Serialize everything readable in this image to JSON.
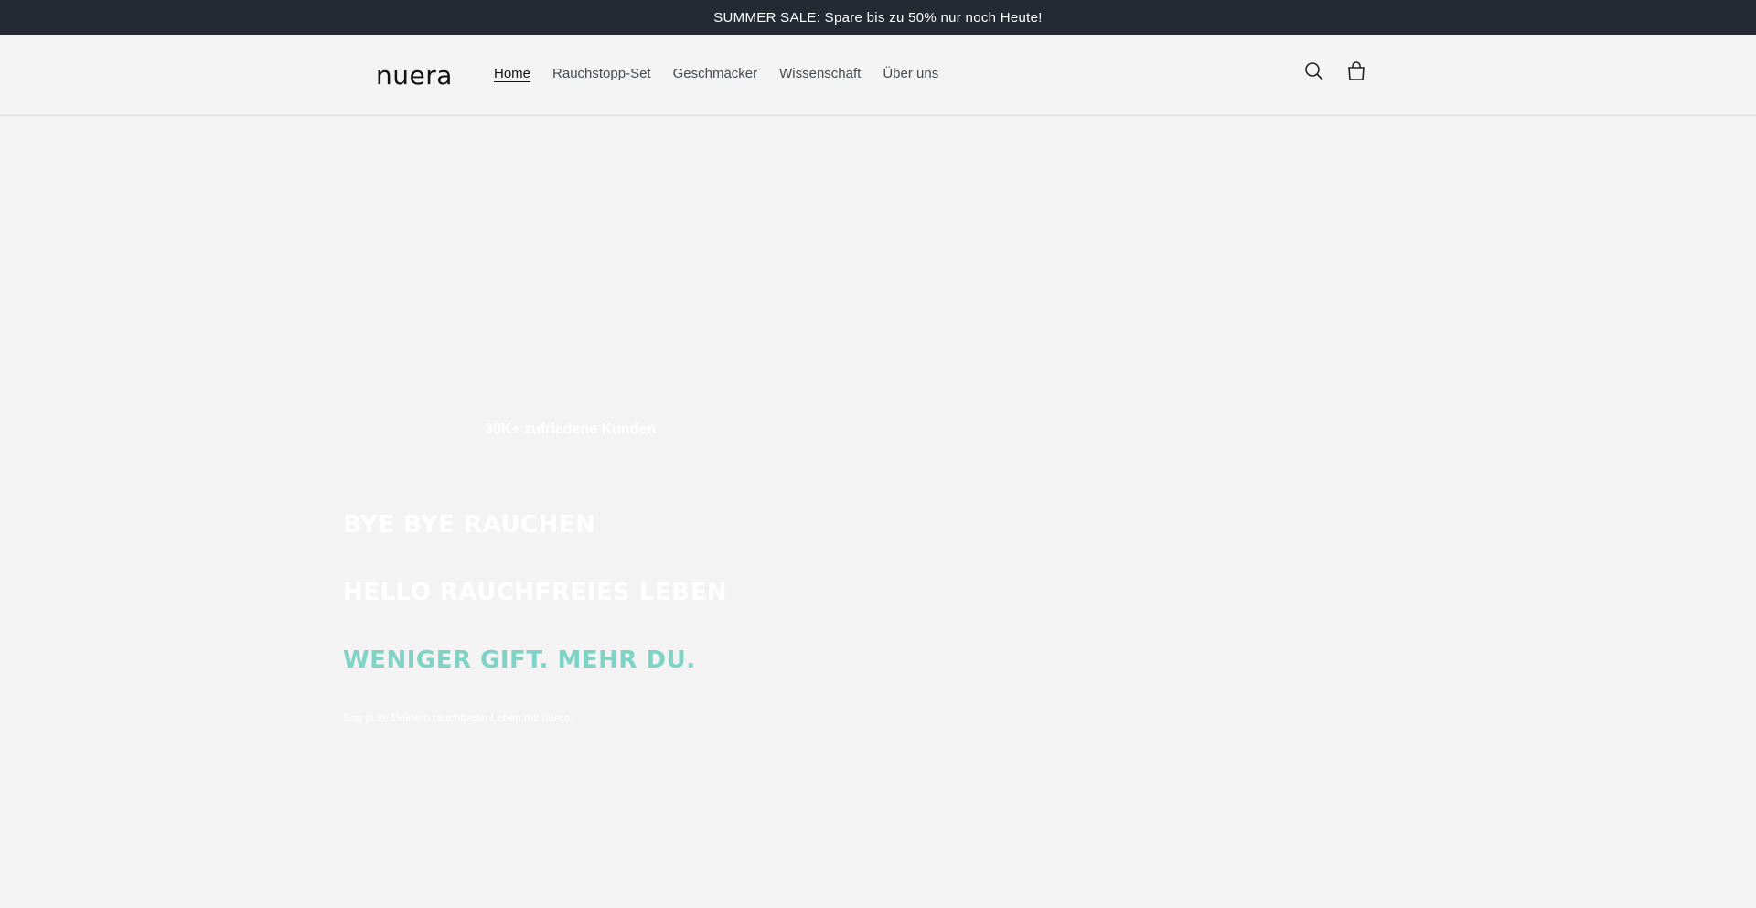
{
  "announcement": {
    "text": "SUMMER SALE: Spare bis zu 50% nur noch Heute!"
  },
  "header": {
    "logo_text": "nuera",
    "nav": [
      {
        "label": "Home",
        "active": true
      },
      {
        "label": "Rauchstopp-Set",
        "active": false
      },
      {
        "label": "Geschmäcker",
        "active": false
      },
      {
        "label": "Wissenschaft",
        "active": false
      },
      {
        "label": "Über uns",
        "active": false
      }
    ],
    "icons": {
      "search": "search-icon",
      "cart": "cart-icon"
    }
  },
  "hero": {
    "customers_text": "30K+ zufriedene Kunden",
    "headline_1": "BYE BYE RAUCHEN",
    "headline_2": "HELLO RAUCHFREIES LEBEN",
    "headline_3": "WENIGER GIFT. MEHR DU.",
    "subtext": "Sag ja zu Deinem rauchfreien Leben mit nuera."
  },
  "colors": {
    "announcement_bg": "#252933",
    "page_bg": "#f3f3f3",
    "accent_teal": "#7fd3c6",
    "text_dark": "#121212"
  }
}
